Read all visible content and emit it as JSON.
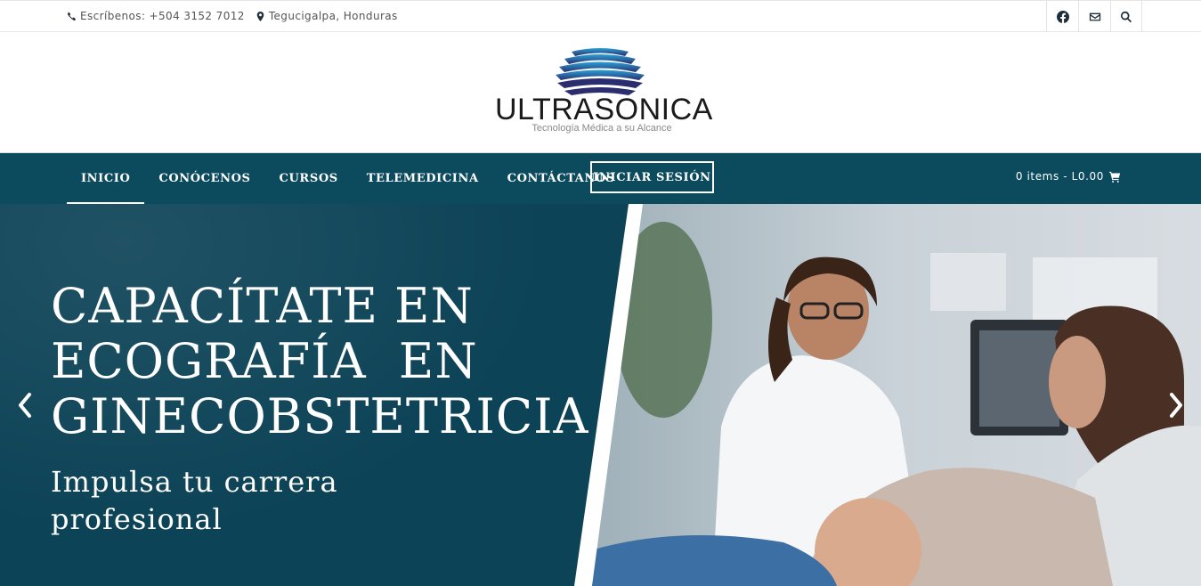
{
  "topbar": {
    "phone": "Escríbenos: +504 3152 7012",
    "location": "Tegucigalpa, Honduras",
    "icons": [
      "phone-icon",
      "map-marker-icon",
      "facebook-icon",
      "envelope-icon",
      "search-icon"
    ]
  },
  "logo": {
    "brand": "ULTRASONICA",
    "tagline": "Tecnología Médica a su Alcance"
  },
  "nav": {
    "items": [
      {
        "label": "INICIO",
        "active": true
      },
      {
        "label": "CONÓCENOS"
      },
      {
        "label": "CURSOS"
      },
      {
        "label": "TELEMEDICINA"
      },
      {
        "label": "CONTÁCTANOS"
      }
    ],
    "login": "INICIAR SESIÓN",
    "cart": "0 items - L0.00",
    "cart_icon": "cart-icon"
  },
  "hero": {
    "title_lines": [
      "CAPACÍTATE EN",
      "ECOGRAFÍA  EN",
      "GINECOBSTETRICIA"
    ],
    "subtitle_lines": [
      "Impulsa tu carrera",
      "profesional"
    ],
    "prev_icon": "chevron-left-icon",
    "next_icon": "chevron-right-icon"
  },
  "colors": {
    "nav_bg": "#0c4a5e",
    "hero_bg": "#0d4357",
    "wave_dark": "#2b2d6e",
    "wave_light": "#2aa3d8"
  }
}
